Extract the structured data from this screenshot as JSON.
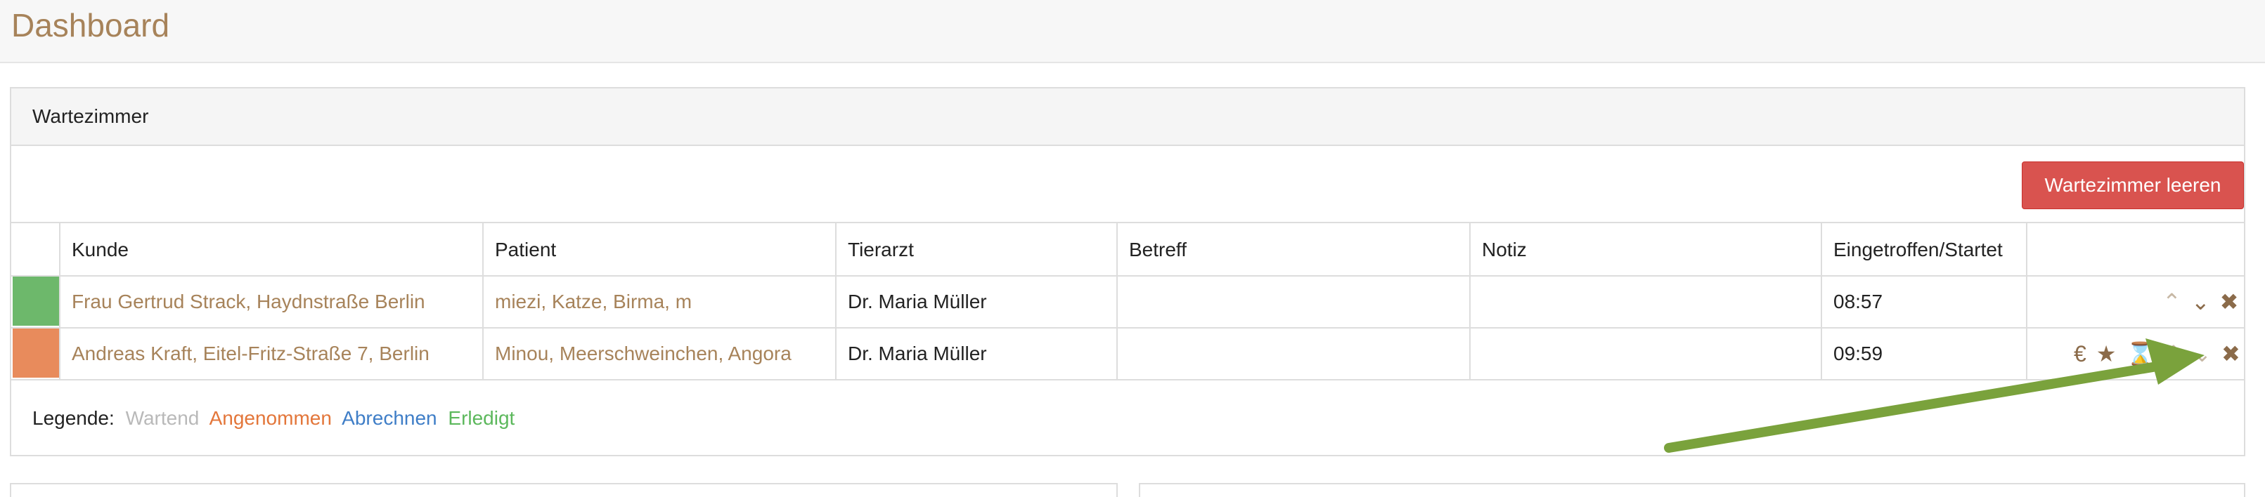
{
  "page": {
    "title": "Dashboard"
  },
  "waiting_room": {
    "title": "Wartezimmer",
    "empty_button": "Wartezimmer leeren",
    "columns": [
      "Kunde",
      "Patient",
      "Tierarzt",
      "Betreff",
      "Notiz",
      "Eingetroffen/Startet"
    ],
    "rows": [
      {
        "status_color": "#6db86b",
        "kunde": "Frau Gertrud Strack, Haydnstraße Berlin",
        "patient": "miezi, Katze, Birma, m",
        "tierarzt": "Dr. Maria Müller",
        "betreff": "",
        "notiz": "",
        "time": "08:57",
        "actions": [
          "chevron-up-icon",
          "chevron-down-icon",
          "close-icon"
        ]
      },
      {
        "status_color": "#e88b5c",
        "kunde": "Andreas Kraft, Eitel-Fritz-Straße 7, Berlin",
        "patient": "Minou, Meerschweinchen, Angora",
        "tierarzt": "Dr. Maria Müller",
        "betreff": "",
        "notiz": "",
        "time": "09:59",
        "actions": [
          "euro-icon",
          "star-icon",
          "hourglass-icon",
          "chevron-up-icon",
          "chevron-down-icon",
          "close-icon"
        ]
      }
    ],
    "legend": {
      "label": "Legende:",
      "items": [
        {
          "text": "Wartend",
          "color": "#b9b9b9"
        },
        {
          "text": "Angenommen",
          "color": "#e3763a"
        },
        {
          "text": "Abrechnen",
          "color": "#3f7ec7"
        },
        {
          "text": "Erledigt",
          "color": "#5cb85c"
        }
      ]
    }
  },
  "annotation": {
    "arrow_color": "#7aa23c"
  },
  "colors": {
    "accent": "#a7835a",
    "danger": "#d9534f",
    "border": "#dddddd"
  }
}
